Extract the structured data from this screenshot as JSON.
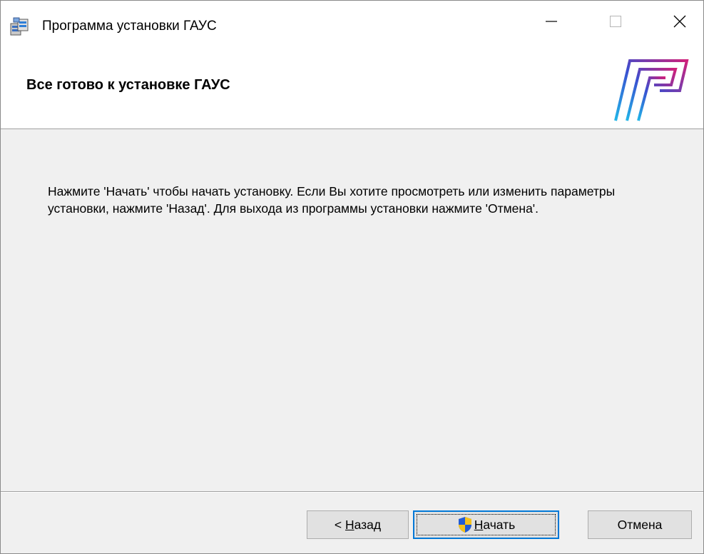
{
  "window": {
    "title": "Программа установки ГАУС"
  },
  "header": {
    "title": "Все готово к установке ГАУС"
  },
  "content": {
    "message": "Нажмите 'Начать' чтобы начать установку. Если Вы хотите просмотреть или изменить параметры установки, нажмите 'Назад'. Для выхода из программы установки нажмите 'Отмена'."
  },
  "buttons": {
    "back": {
      "prefix": "< ",
      "accel": "Н",
      "rest": "азад"
    },
    "start": {
      "accel": "Н",
      "rest": "ачать"
    },
    "cancel": {
      "label": "Отмена"
    }
  },
  "colors": {
    "accent": "#0078d7",
    "button_face": "#e1e1e1",
    "dialog_bg": "#f0f0f0"
  },
  "icons": {
    "title": "installer-icon",
    "logo": "gaus-logo",
    "minimize": "minimize-icon",
    "maximize": "maximize-icon",
    "close": "close-icon",
    "shield": "uac-shield-icon"
  }
}
